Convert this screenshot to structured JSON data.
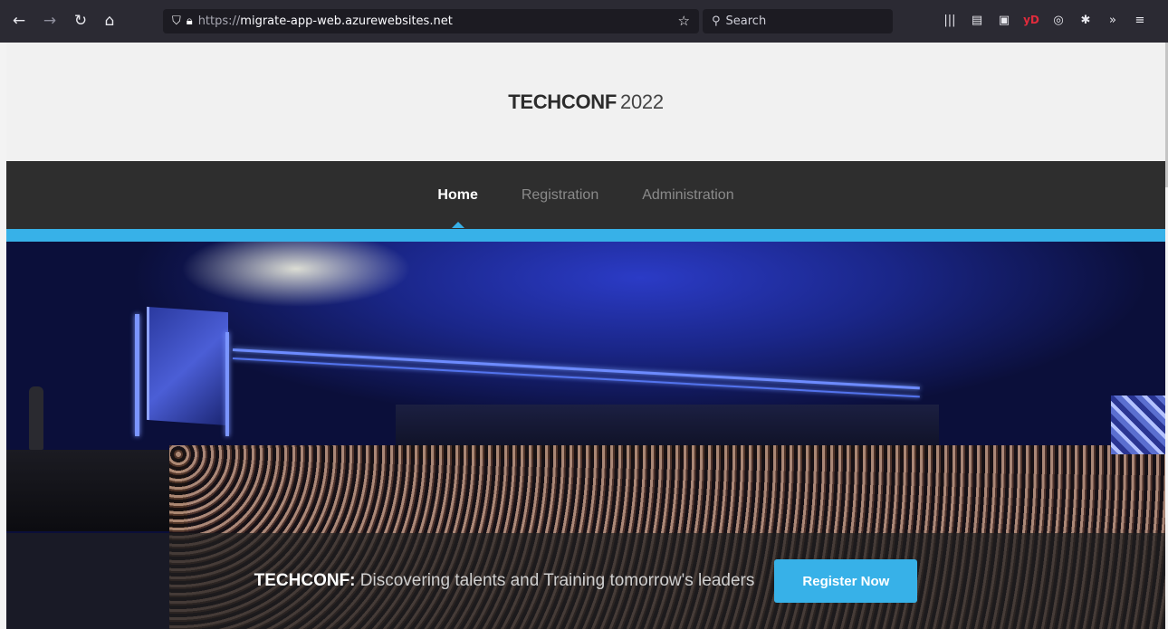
{
  "browser": {
    "url_protocol": "https://",
    "url_host": "migrate-app-web.azurewebsites.net",
    "search_placeholder": "Search"
  },
  "site": {
    "brand": "TECHCONF",
    "year": "2022"
  },
  "nav": {
    "items": [
      {
        "label": "Home",
        "active": true
      },
      {
        "label": "Registration",
        "active": false
      },
      {
        "label": "Administration",
        "active": false
      }
    ]
  },
  "banner": {
    "brand": "TECHCONF:",
    "tagline": "Discovering talents and Training tomorrow's leaders",
    "cta_label": "Register Now"
  },
  "colors": {
    "accent": "#37b1e8",
    "navbar_bg": "#2e2e2e",
    "browser_bg": "#2b2a33"
  },
  "icons": {
    "browser": [
      "back-icon",
      "forward-icon",
      "reload-icon",
      "home-icon",
      "shield-icon",
      "lock-icon",
      "bookmark-star-icon",
      "search-icon",
      "library-icon",
      "reader-view-icon",
      "extension-icon",
      "menu-icon"
    ]
  }
}
